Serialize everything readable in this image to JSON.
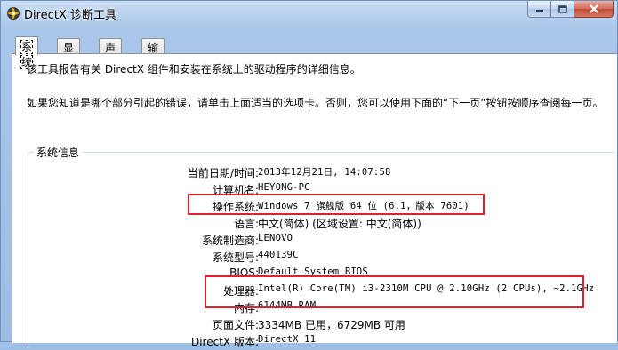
{
  "window": {
    "title": "DirectX 诊断工具",
    "controls": {
      "minimize_icon": "minimize-icon",
      "maximize_icon": "maximize-icon",
      "close_icon": "close-icon"
    }
  },
  "tabs": [
    {
      "label": "系统",
      "active": true
    },
    {
      "label": "显示",
      "active": false
    },
    {
      "label": "声音",
      "active": false
    },
    {
      "label": "输入",
      "active": false
    }
  ],
  "intro": {
    "line1": "该工具报告有关 DirectX 组件和安装在系统上的驱动程序的详细信息。",
    "line2": "如果您知道是哪个部分引起的错误，请单击上面适当的选项卡。否则，您可以使用下面的“下一页”按钮按顺序查阅每一页。"
  },
  "system_info": {
    "group_label": "系统信息",
    "rows": [
      {
        "label": "当前日期/时间:",
        "value": "2013年12月21日, 14:07:58"
      },
      {
        "label": "计算机名:",
        "value": "HEYONG-PC"
      },
      {
        "label": "操作系统:",
        "value": "Windows 7 旗舰版 64 位 (6.1，版本 7601)"
      },
      {
        "label": "语言:",
        "value": "中文(简体) (区域设置: 中文(简体))"
      },
      {
        "label": "系统制造商:",
        "value": "LENOVO"
      },
      {
        "label": "系统型号:",
        "value": "440139C"
      },
      {
        "label": "BIOS:",
        "value": "Default System BIOS"
      },
      {
        "label": "处理器:",
        "value": "Intel(R) Core(TM) i3-2310M CPU @ 2.10GHz (2 CPUs), ~2.1GHz"
      },
      {
        "label": "内存:",
        "value": "6144MB RAM"
      },
      {
        "label": "页面文件:",
        "value": "3334MB 已用，6729MB 可用"
      },
      {
        "label": "DirectX 版本:",
        "value": "DirectX 11"
      }
    ]
  },
  "colors": {
    "highlight": "#e0202a",
    "title_bg": "#aac7ea"
  }
}
